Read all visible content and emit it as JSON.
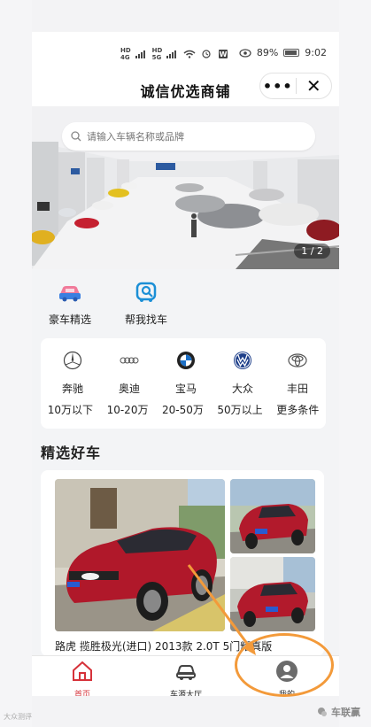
{
  "status": {
    "left_icons": [
      "HD",
      "4G",
      "HD",
      "5G",
      "signal",
      "wifi",
      "alarm",
      "app"
    ],
    "battery": "89%",
    "time": "9:02"
  },
  "titlebar": {
    "title": "诚信优选商铺",
    "more": "•••",
    "close": "✕"
  },
  "banner": {
    "search_placeholder": "请输入车辆名称或品牌",
    "pager": "1 / 2"
  },
  "quick": [
    {
      "label": "豪车精选",
      "icon": "luxury-car-icon"
    },
    {
      "label": "帮我找车",
      "icon": "find-car-icon"
    }
  ],
  "brands": [
    {
      "label": "奔驰",
      "icon": "mercedes-logo-icon"
    },
    {
      "label": "奥迪",
      "icon": "audi-logo-icon"
    },
    {
      "label": "宝马",
      "icon": "bmw-logo-icon"
    },
    {
      "label": "大众",
      "icon": "volkswagen-logo-icon"
    },
    {
      "label": "丰田",
      "icon": "toyota-logo-icon"
    }
  ],
  "prices": [
    "10万以下",
    "10-20万",
    "20-50万",
    "50万以上",
    "更多条件"
  ],
  "section": {
    "title": "精选好车"
  },
  "featured": {
    "name": "路虎 揽胜极光(进口) 2013款 2.0T 5门耀真版"
  },
  "tabs": [
    {
      "label": "首页",
      "icon": "home-icon",
      "active": true
    },
    {
      "label": "车源大厅",
      "icon": "car-icon",
      "active": false
    },
    {
      "label": "我的",
      "icon": "user-icon",
      "active": false
    }
  ],
  "watermark": {
    "left": "大众测评",
    "right": "车联赢"
  },
  "colors": {
    "accent": "#d6323a",
    "annotation": "#f39a3a",
    "brand_blue": "#1b8fd6"
  }
}
